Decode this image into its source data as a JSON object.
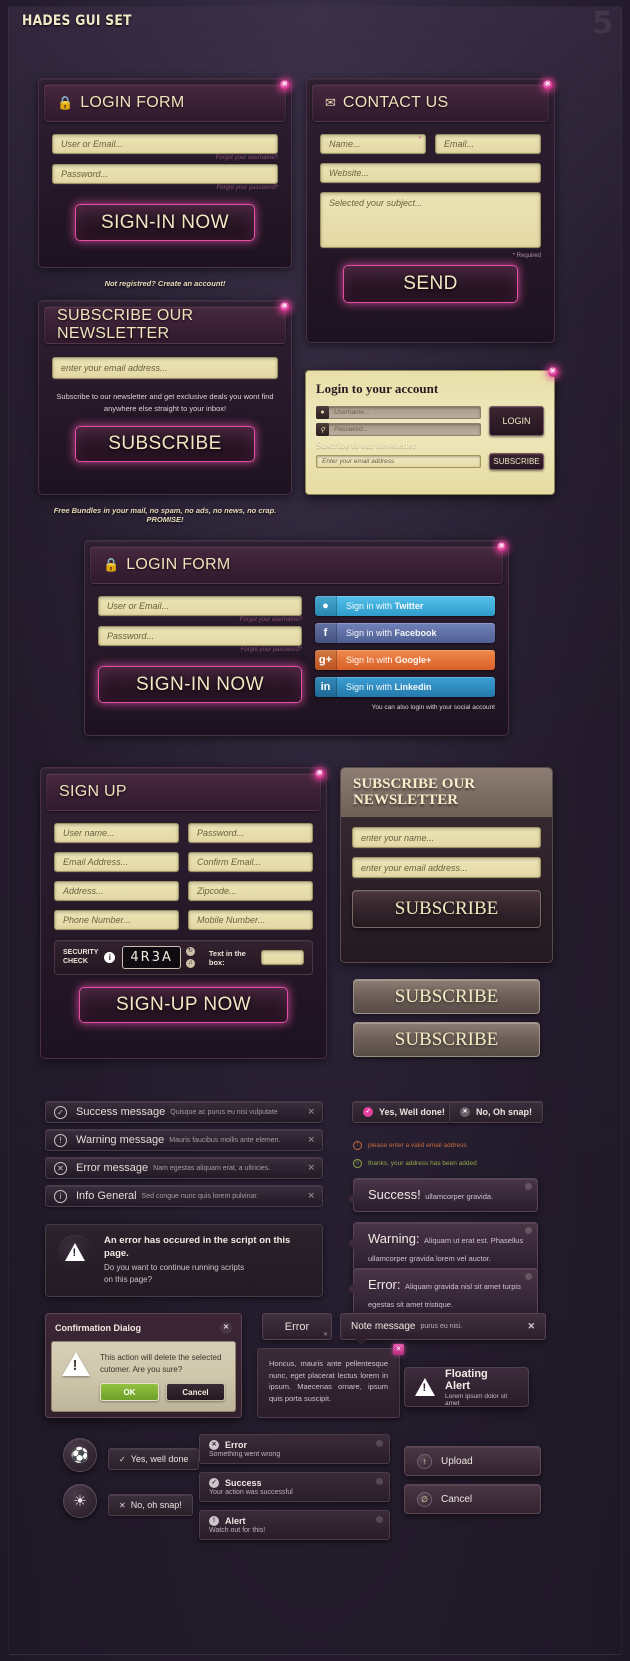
{
  "header": {
    "title": "HADES GUI SET",
    "number": "5"
  },
  "login_form": {
    "title": "LOGIN FORM",
    "icon": "lock-icon",
    "user_placeholder": "User or Email...",
    "pass_placeholder": "Password...",
    "forgot_user": "Forgot your username?",
    "forgot_pass": "Forgot your password?",
    "submit": "SIGN-IN NOW",
    "caption": "Not registred? Create an account!"
  },
  "contact_form": {
    "title": "CONTACT US",
    "icon": "envelope-icon",
    "name_placeholder": "Name...",
    "email_placeholder": "Email...",
    "website_placeholder": "Website...",
    "subject_placeholder": "Selected your subject...",
    "required_note": "* Required",
    "submit": "SEND"
  },
  "newsletter": {
    "title": "SUBSCRIBE OUR NEWSLETTER",
    "email_placeholder": "enter your email address...",
    "description": "Subscribe to our newsletter and get exclusive deals you wont find anywhere else straight to your inbox!",
    "submit": "SUBSCRIBE",
    "caption": "Free Bundles in your mail, no spam, no ads, no news, no crap. PROMISE!"
  },
  "account_panel": {
    "title": "Login to your account",
    "username_placeholder": "Username...",
    "password_placeholder": "Password...",
    "login_button": "LOGIN",
    "subscribe_heading": "Suscribe to our newsletter",
    "email_placeholder": "Enter your email address",
    "subscribe_button": "SUBSCRIBE"
  },
  "social_login": {
    "title": "LOGIN FORM",
    "icon": "lock-icon",
    "user_placeholder": "User or Email...",
    "pass_placeholder": "Password...",
    "forgot_user": "Forgot your username?",
    "forgot_pass": "Forgot your password?",
    "submit": "SIGN-IN NOW",
    "note": "You can also login with your social account",
    "buttons": [
      {
        "glyph": "t",
        "prefix": "Sign in with ",
        "network": "Twitter",
        "color": "#3fb3e3",
        "icon": "twitter-icon"
      },
      {
        "glyph": "f",
        "prefix": "Sign in with ",
        "network": "Facebook",
        "color": "#5d6fa8",
        "icon": "facebook-icon"
      },
      {
        "glyph": "g+",
        "prefix": "Sign In with ",
        "network": "Google+",
        "color": "#e8763c",
        "icon": "googleplus-icon"
      },
      {
        "glyph": "in",
        "prefix": "Sign in with ",
        "network": "Linkedin",
        "color": "#2f8fc4",
        "icon": "linkedin-icon"
      }
    ]
  },
  "signup": {
    "title": "SIGN UP",
    "fields": [
      "User name...",
      "Password...",
      "Email Address...",
      "Confirm Email...",
      "Address...",
      "Zipcode...",
      "Phone Number...",
      "Mobile Number..."
    ],
    "security_label_1": "SECURITY",
    "security_label_2": "CHECK",
    "captcha_text": "4R3A",
    "text_in_box_label": "Text in the box:",
    "submit": "SIGN-UP NOW"
  },
  "newsletter_brown": {
    "title_line1": "SUBSCRIBE OUR",
    "title_line2": "NEWSLETTER",
    "name_placeholder": "enter your name...",
    "email_placeholder": "enter your email address...",
    "submit": "SUBSCRIBE",
    "extra_buttons": [
      "SUBSCRIBE",
      "SUBSCRIBE"
    ]
  },
  "alert_bars": [
    {
      "icon": "check-circle-icon",
      "glyph": "✓",
      "title": "Success message",
      "sub": "Quisque ac purus eu nisi vulputate"
    },
    {
      "icon": "exclamation-circle-icon",
      "glyph": "!",
      "title": "Warning message",
      "sub": "Mauris faucibus mollis ante elemen."
    },
    {
      "icon": "times-circle-icon",
      "glyph": "✕",
      "title": "Error message",
      "sub": "Nam egestas aliquam erat, a ultricies."
    },
    {
      "icon": "info-circle-icon",
      "glyph": "i",
      "title": "Info General",
      "sub": "Sed congue nunc quis lorem pulvinar."
    }
  ],
  "pills": [
    {
      "label": "Yes, Well done!",
      "icon": "check-dot-icon",
      "glyph": "✓"
    },
    {
      "label": "No, Oh snap!",
      "icon": "times-dot-icon",
      "glyph": "✕"
    }
  ],
  "validations": [
    {
      "text": "please enter a valid email address",
      "color": "#c4683d",
      "icon": "error-face-icon",
      "glyph": "!"
    },
    {
      "text": "thanks, your address has been added",
      "color": "#8fa846",
      "icon": "happy-face-icon",
      "glyph": "☺"
    }
  ],
  "bubbles": [
    {
      "title": "Success!",
      "sub": "ullamcorper gravida.",
      "icon": "success-bubble"
    },
    {
      "title": "Warning:",
      "sub": "Aliquam ut erat est. Phasellus ullamcorper gravida lorem vel auctor.",
      "icon": "warning-bubble"
    },
    {
      "title": "Error:",
      "sub": "Aliquam gravida nisl sit amet turpis egestas sit amet tristique.",
      "icon": "error-bubble"
    }
  ],
  "script_error": {
    "icon": "warning-triangle-icon",
    "title": "An error has occured in the script on this page.",
    "line1": "Do you want to continue running scripts",
    "line2": "on this page?"
  },
  "confirmation_dialog": {
    "title": "Confirmation Dialog",
    "close_icon": "close-icon",
    "warning_icon": "warning-triangle-icon",
    "message_line1": "This action will delete the selected",
    "message_line2": "cutomer.  Are you sure?",
    "ok_label": "OK",
    "cancel_label": "Cancel"
  },
  "error_tab": {
    "label": "Error"
  },
  "note_message": {
    "title": "Note message",
    "sub": "purus eu nisi.",
    "close": "✕"
  },
  "paragraph_box": {
    "text": "Honcus, mauris ante pellentesque nunc, eget placerat lectus lorem in ipsum. Maecenas ornare, ipsum quis porta suscipit."
  },
  "floating_alert": {
    "title": "Floating Alert",
    "sub": "Lorem ipsum dolor sit amet",
    "icon": "warning-triangle-icon"
  },
  "bottom_pills": [
    {
      "label": "Yes, well done",
      "icon": "check-icon",
      "glyph": "✓"
    },
    {
      "label": "No, oh snap!",
      "icon": "times-icon",
      "glyph": "✕"
    }
  ],
  "bottom_messages": [
    {
      "title": "Error",
      "sub": "Something went wrong",
      "icon": "times-circle-icon",
      "glyph": "✕"
    },
    {
      "title": "Success",
      "sub": "Your action was successful",
      "icon": "check-circle-icon",
      "glyph": "✓"
    },
    {
      "title": "Alert",
      "sub": "Watch out for this!",
      "icon": "exclamation-circle-icon",
      "glyph": "!"
    }
  ],
  "action_buttons": [
    {
      "label": "Upload",
      "icon": "upload-icon",
      "glyph": "↑"
    },
    {
      "label": "Cancel",
      "icon": "ban-icon",
      "glyph": "∅"
    }
  ]
}
